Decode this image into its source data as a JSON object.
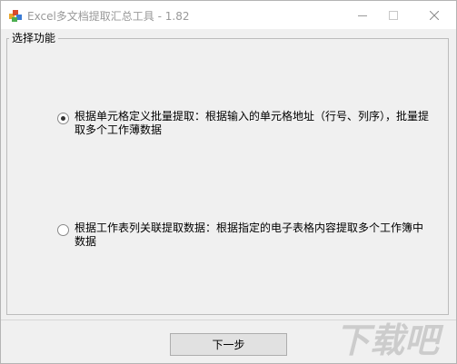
{
  "window": {
    "title": "Excel多文档提取汇总工具 - 1.82"
  },
  "group": {
    "title": "选择功能"
  },
  "options": [
    {
      "label": "根据单元格定义批量提取：根据输入的单元格地址（行号、列序），批量提取多个工作薄数据",
      "checked": true
    },
    {
      "label": "根据工作表列关联提取数据：根据指定的电子表格内容提取多个工作簿中数据",
      "checked": false
    }
  ],
  "buttons": {
    "next": "下一步"
  },
  "watermark": {
    "text": "下载吧"
  }
}
